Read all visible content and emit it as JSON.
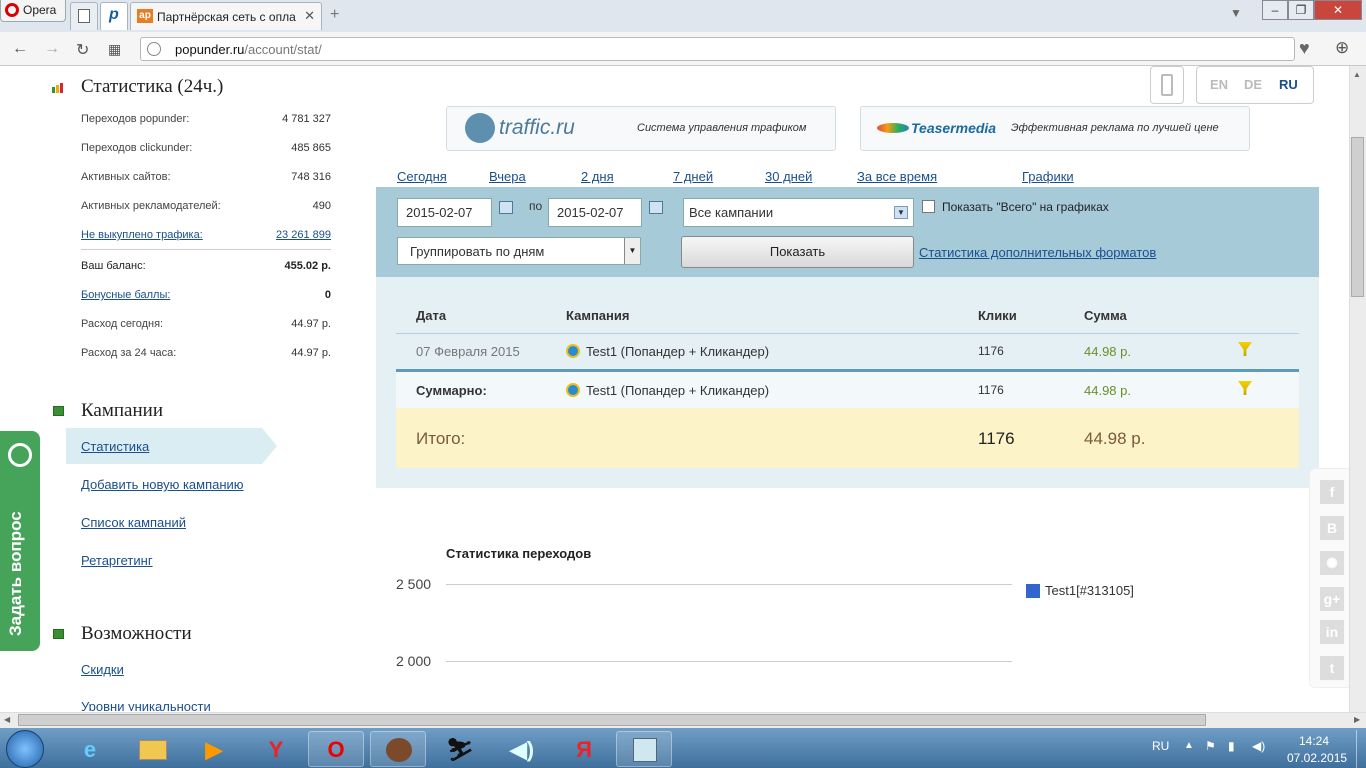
{
  "browser": {
    "opera_label": "Opera",
    "tab_title": "Партнёрская сеть с опла",
    "url_host": "popunder.ru",
    "url_path": "/account/stat/"
  },
  "sidebar": {
    "stats_heading": "Статистика (24ч.)",
    "stats": [
      {
        "label": "Переходов popunder:",
        "value": "4 781 327"
      },
      {
        "label": "Переходов clickunder:",
        "value": "485 865"
      },
      {
        "label": "Активных сайтов:",
        "value": "748 316"
      },
      {
        "label": "Активных рекламодателей:",
        "value": "490"
      },
      {
        "label": "Не выкуплено трафика:",
        "value": "23 261 899"
      },
      {
        "label": "Ваш баланс:",
        "value": "455.02 р."
      },
      {
        "label": "Бонусные баллы:",
        "value": "0"
      },
      {
        "label": "Расход сегодня:",
        "value": "44.97 р."
      },
      {
        "label": "Расход за 24 часа:",
        "value": "44.97 р."
      }
    ],
    "campaigns_heading": "Кампании",
    "campaigns_menu": [
      "Статистика",
      "Добавить новую кампанию",
      "Список кампаний",
      "Ретаргетинг"
    ],
    "features_heading": "Возможности",
    "features_menu": [
      "Скидки",
      "Уровни уникальности"
    ],
    "ask_question": "Задать вопрос"
  },
  "header": {
    "langs": [
      "EN",
      "DE",
      "RU"
    ],
    "banner1_logo": "traffic.ru",
    "banner1_text": "Система управления трафиком",
    "banner2_logo": "Teasermedia",
    "banner2_text": "Эффективная реклама по лучшей цене"
  },
  "filters": {
    "periods": [
      "Сегодня",
      "Вчера",
      "2 дня",
      "7 дней",
      "30 дней",
      "За все время",
      "Графики"
    ],
    "date_from": "2015-02-07",
    "to_label": "по",
    "date_to": "2015-02-07",
    "campaign_select": "Все кампании",
    "show_total_label": "Показать \"Всего\" на графиках",
    "group_select": "Группировать по дням",
    "show_button": "Показать",
    "extra_formats_link": "Статистика дополнительных форматов"
  },
  "table": {
    "headers": [
      "Дата",
      "Кампания",
      "Клики",
      "Сумма"
    ],
    "row": {
      "date": "07 Февраля 2015",
      "campaign": "Test1 (Попандер + Кликандер)",
      "clicks": "1176",
      "sum": "44.98 р."
    },
    "summary": {
      "label": "Суммарно:",
      "campaign": "Test1 (Попандер + Кликандер)",
      "clicks": "1176",
      "sum": "44.98 р."
    },
    "total": {
      "label": "Итого:",
      "clicks": "1176",
      "sum": "44.98 р."
    }
  },
  "chart_data": {
    "type": "line",
    "title": "Статистика переходов",
    "y_ticks": [
      "2 500",
      "2 000"
    ],
    "series": [
      {
        "name": "Test1[#313105]",
        "color": "#3366cc",
        "values": []
      }
    ]
  },
  "social": [
    "f",
    "B",
    "✺",
    "g+",
    "in",
    "t"
  ],
  "taskbar": {
    "lang": "RU",
    "time": "14:24",
    "date": "07.02.2015"
  }
}
